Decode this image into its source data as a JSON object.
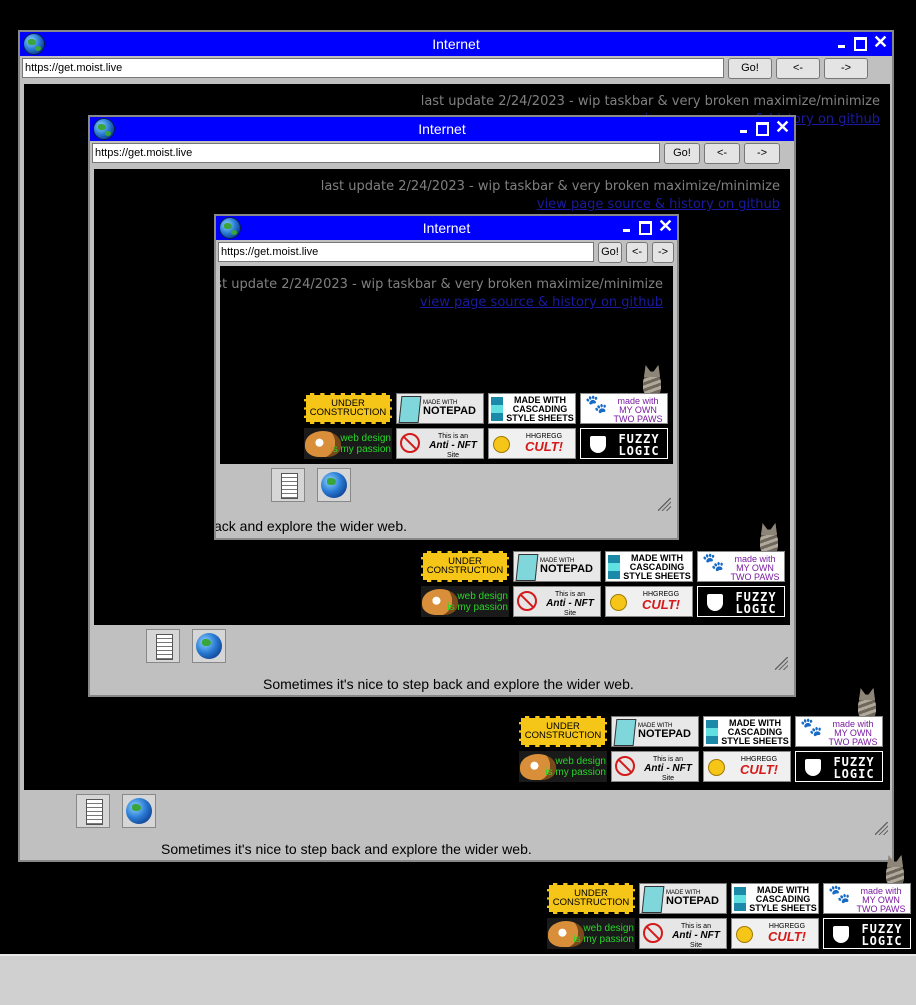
{
  "window": {
    "title": "Internet",
    "url": "https://get.moist.live",
    "go_label": "Go!",
    "back_label": "<-",
    "forward_label": "->",
    "close_glyph": "✕"
  },
  "page": {
    "update_text": "last update 2/24/2023 - wip taskbar & very broken maximize/minimize",
    "source_link": "view page source & history on github",
    "caption": "Sometimes it's nice to step back and explore the wider web.",
    "caption_clipped": "ack and explore the wider web."
  },
  "badges": {
    "under_construction": [
      "UNDER",
      "CONSTRUCTION"
    ],
    "notepad": [
      "MADE WITH",
      "NOTEPAD"
    ],
    "css": [
      "MADE WITH",
      "CASCADING",
      "STYLE SHEETS"
    ],
    "paws": [
      "made with",
      "MY OWN",
      "TWO PAWS"
    ],
    "webdesign": [
      "web design",
      "is my passion"
    ],
    "antinft": [
      "This is an",
      "Anti - NFT",
      "Site"
    ],
    "hhgregg": [
      "HHGREGG",
      "CULT!"
    ],
    "fuzzy": [
      "FUZZY",
      "LOGIC"
    ]
  },
  "colors": {
    "titlebar": "#0000ff",
    "viewport": "#000000",
    "chrome": "#c0c0c0",
    "link": "#1a1aa0",
    "update_text": "#808080"
  },
  "icons": [
    "globe-icon",
    "minimize-icon",
    "maximize-icon",
    "close-icon",
    "notepad-icon",
    "internet-globe-icon",
    "resize-grip-icon",
    "cat-icon"
  ]
}
